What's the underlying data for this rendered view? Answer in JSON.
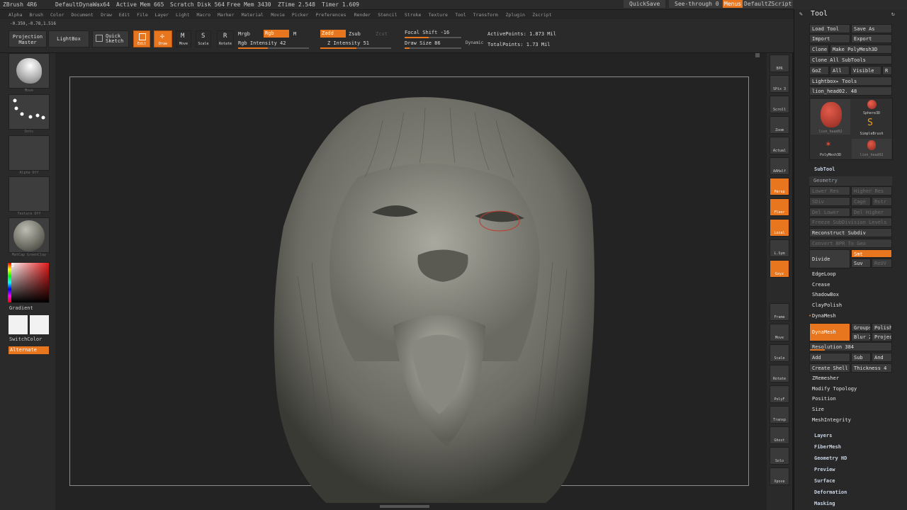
{
  "titlebar": {
    "app": "ZBrush 4R6",
    "project": "DefaultDynaWax64",
    "active_mem": "Active Mem 665",
    "scratch_disk": "Scratch Disk 564",
    "free_mem": "Free Mem 3430",
    "ztime": "ZTime 2.548",
    "timer": "Timer 1.609",
    "quicksave": "QuickSave",
    "see_through": "See-through 0",
    "menus": "Menus",
    "zscript": "DefaultZScript"
  },
  "menubar": [
    "Alpha",
    "Brush",
    "Color",
    "Document",
    "Draw",
    "Edit",
    "File",
    "Layer",
    "Light",
    "Macro",
    "Marker",
    "Material",
    "Movie",
    "Picker",
    "Preferences",
    "Render",
    "Stencil",
    "Stroke",
    "Texture",
    "Tool",
    "Transform",
    "Zplugin",
    "Zscript"
  ],
  "toolbar": {
    "coords": "-0.359,-0.78,1.516",
    "projection_master": "Projection Master",
    "lightbox": "LightBox",
    "quick_sketch": "Quick Sketch",
    "edit": "Edit",
    "draw": "Draw",
    "move": "Move",
    "scale": "Scale",
    "rotate": "Rotate",
    "mrgb": "Mrgb",
    "rgb": "Rgb",
    "m": "M",
    "rgb_intensity": "Rgb Intensity 42",
    "rgb_intensity_value": 42,
    "zadd": "Zadd",
    "zsub": "Zsub",
    "zcut": "Zcut",
    "z_intensity": "Z Intensity 51",
    "z_intensity_value": 51,
    "focal_shift": "Focal Shift -16",
    "focal_shift_value": -16,
    "draw_size": "Draw Size 86",
    "draw_size_value": 86,
    "dynamic": "Dynamic",
    "active_points": "ActivePoints: 1.873 Mil",
    "total_points": "TotalPoints: 1.73 Mil"
  },
  "leftshelf": {
    "brush_caption": "Move",
    "stroke_caption": "Dots",
    "alpha_caption": "Alpha Off",
    "texture_caption": "Texture Off",
    "material_caption": "MatCap GreenClay",
    "gradient": "Gradient",
    "switchcolor": "SwitchColor",
    "alternate": "Alternate"
  },
  "rightshelf": [
    "BPR",
    "SPix 3",
    "Scroll",
    "Zoom",
    "Actual",
    "AAHalf",
    "Persp",
    "Floor",
    "Local",
    "L.Sym",
    "Gxyz",
    "",
    "",
    "Frame",
    "Move",
    "Scale",
    "Rotate",
    "PolyF",
    "Transp",
    "Ghost",
    "Solo",
    "Xpose"
  ],
  "tray": {
    "title": "Tool",
    "buttons": {
      "load_tool": "Load Tool",
      "save_as": "Save As",
      "import": "Import",
      "export": "Export",
      "clone": "Clone",
      "make_polymesh": "Make PolyMesh3D",
      "clone_all": "Clone All SubTools",
      "goz": "GoZ",
      "all": "All",
      "visible": "Visible",
      "r": "R"
    },
    "lightbox_tools": "Lightbox▸ Tools",
    "current_tool": "lion_head02. 48",
    "tool_thumbs": [
      "lion_head02",
      "Sphere3D",
      "SimpleBrush",
      "PolyMesh3D",
      "lion_head02"
    ],
    "subtool": "SubTool",
    "geometry": "Geometry",
    "geometry_dim": [
      "Lower Res",
      "Higher Res",
      "SDiv",
      "Cage",
      "Rstr",
      "Del Lower",
      "Del Higher",
      "Freeze SubDivision Levels",
      "Convert BPR To Geo"
    ],
    "reconstruct": "Reconstruct Subdiv",
    "divide": "Divide",
    "smt": "Smt",
    "suv": "Suv",
    "rsmt": "ReUV",
    "edgeloop": "EdgeLoop",
    "crease": "Crease",
    "shadowbox": "ShadowBox",
    "claypolish": "ClayPolish",
    "dynamesh_header": "DynaMesh",
    "dynamesh": "DynaMesh",
    "groups": "Groups",
    "polish": "Polish",
    "blur": "Blur 2",
    "projec": "Projec",
    "resolution": "Resolution 384",
    "resolution_value": 384,
    "add": "Add",
    "sub": "Sub",
    "and": "And",
    "create_shell": "Create Shell",
    "thickness": "Thickness 4",
    "zremesher": "ZRemesher",
    "modify_topology": "Modify Topology",
    "position": "Position",
    "size": "Size",
    "meshintegrity": "MeshIntegrity",
    "layers": "Layers",
    "fibermesh": "FiberMesh",
    "geometry_hd": "Geometry HD",
    "preview": "Preview",
    "surface": "Surface",
    "deformation": "Deformation",
    "masking": "Masking"
  },
  "colors": {
    "accent": "#e8761f",
    "panel": "#2a2a2a",
    "canvas": "#232323",
    "mesh": "#8a8a80"
  }
}
